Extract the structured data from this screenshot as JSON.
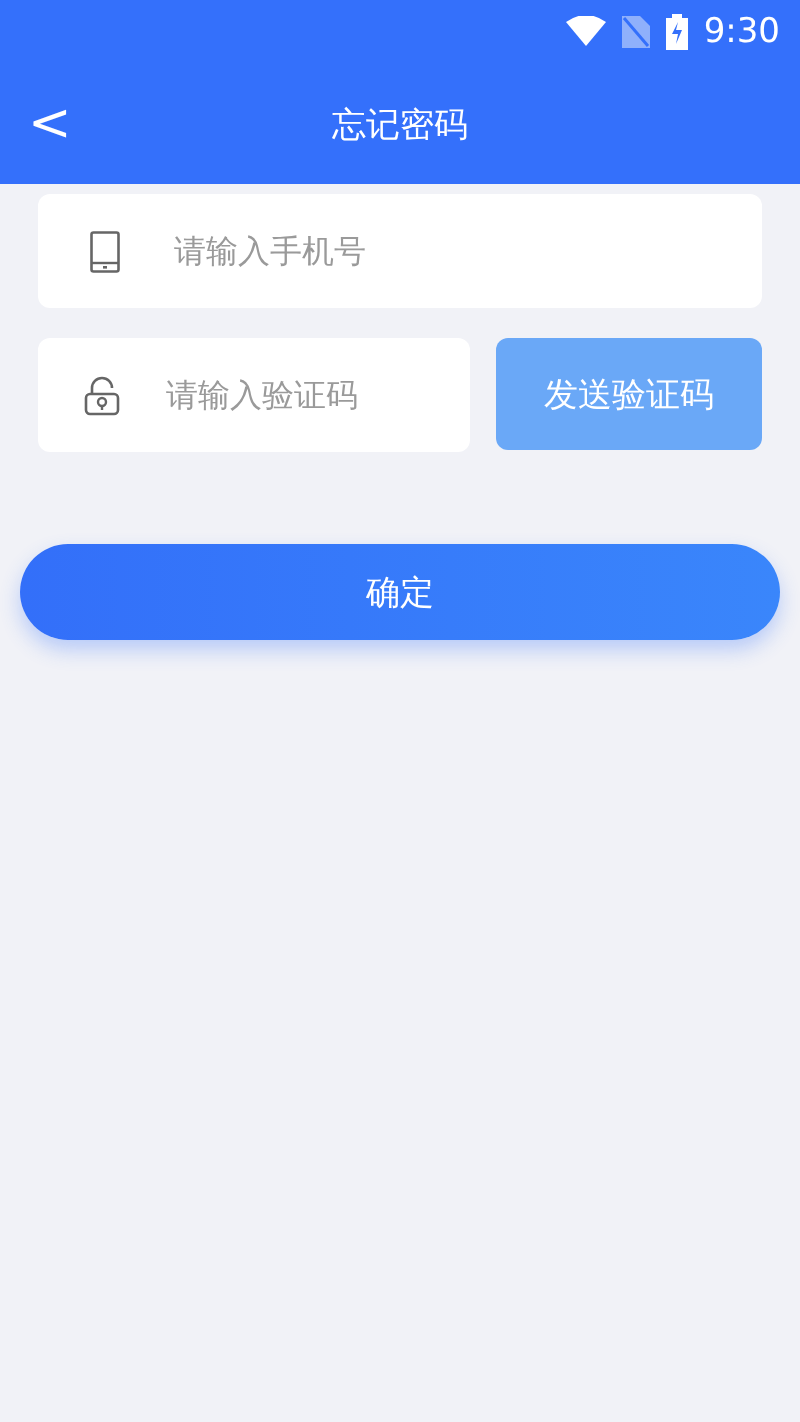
{
  "status_bar": {
    "time": "9:30"
  },
  "header": {
    "title": "忘记密码",
    "back_icon": "<"
  },
  "phone_field": {
    "placeholder": "请输入手机号"
  },
  "code_field": {
    "placeholder": "请输入验证码"
  },
  "send_code_button": {
    "label": "发送验证码",
    "disabled": true
  },
  "confirm_button": {
    "label": "确定"
  }
}
